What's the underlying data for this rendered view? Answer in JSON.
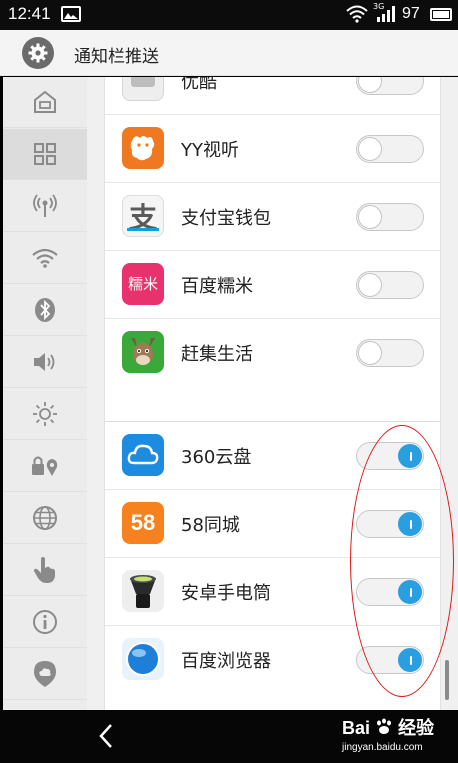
{
  "status_bar": {
    "time": "12:41",
    "network_label": "3G",
    "battery_level": "97"
  },
  "header": {
    "title": "通知栏推送",
    "icon": "gear-icon"
  },
  "sidebar": {
    "items": [
      {
        "icon": "home-icon",
        "active": false
      },
      {
        "icon": "grid-icon",
        "active": true
      },
      {
        "icon": "broadcast-icon",
        "active": false
      },
      {
        "icon": "wifi-icon",
        "active": false
      },
      {
        "icon": "bluetooth-icon",
        "active": false
      },
      {
        "icon": "volume-icon",
        "active": false
      },
      {
        "icon": "brightness-icon",
        "active": false
      },
      {
        "icon": "lock-location-icon",
        "active": false
      },
      {
        "icon": "globe-icon",
        "active": false
      },
      {
        "icon": "hand-icon",
        "active": false
      },
      {
        "icon": "info-icon",
        "active": false
      },
      {
        "icon": "cloud-icon",
        "active": false
      }
    ]
  },
  "apps_group1": [
    {
      "name": "优酷",
      "icon": "youku-icon",
      "enabled": false,
      "color": "#eeeeee",
      "partial": true
    },
    {
      "name": "YY视听",
      "icon": "yy-icon",
      "enabled": false,
      "color": "#f07820"
    },
    {
      "name": "支付宝钱包",
      "icon": "alipay-icon",
      "enabled": false,
      "color": "#f5f5f5"
    },
    {
      "name": "百度糯米",
      "icon": "nuomi-icon",
      "enabled": false,
      "color": "#e8326d",
      "icon_text": "糯米"
    },
    {
      "name": "赶集生活",
      "icon": "ganji-icon",
      "enabled": false,
      "color": "#3aa83a"
    }
  ],
  "apps_group2": [
    {
      "name": "360云盘",
      "icon": "cloud-disk-icon",
      "enabled": true,
      "color": "#1c8be0"
    },
    {
      "name": "58同城",
      "icon": "58-icon",
      "enabled": true,
      "color": "#f5821f",
      "icon_text": "58"
    },
    {
      "name": "安卓手电筒",
      "icon": "flashlight-icon",
      "enabled": true,
      "color": "#eeeeee"
    },
    {
      "name": "百度浏览器",
      "icon": "browser-icon",
      "enabled": true,
      "color": "#e8f2fb"
    }
  ],
  "watermark": {
    "main": "Bai",
    "main_suffix": "经验",
    "sub": "jingyan.baidu.com"
  },
  "colors": {
    "toggle_on": "#2a9fe0",
    "annotation": "#e01818"
  }
}
